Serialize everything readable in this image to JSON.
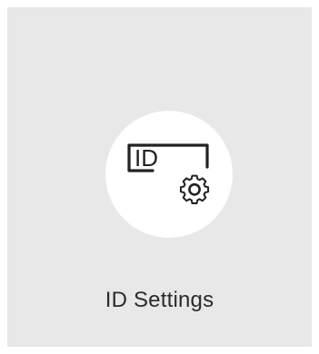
{
  "tile": {
    "label": "ID Settings",
    "icon": "id-settings-icon",
    "icon_badge": "ID",
    "colors": {
      "tile_background": "#e8e8e8",
      "circle_background": "#ffffff",
      "icon_stroke": "#222222",
      "label_text": "#2b2b2b"
    }
  }
}
